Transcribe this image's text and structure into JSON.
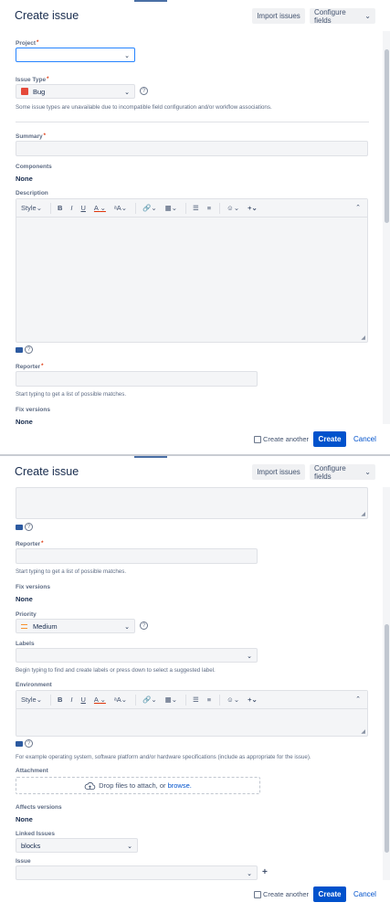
{
  "dialog_title": "Create issue",
  "header": {
    "import_label": "Import issues",
    "configure_label": "Configure fields",
    "configure_caret": "⌄"
  },
  "fields": {
    "project_label": "Project",
    "required_mark": "*",
    "issue_type_label": "Issue Type",
    "issue_type_value": "Bug",
    "issue_type_help": "Some issue types are unavailable due to incompatible field configuration and/or workflow associations.",
    "summary_label": "Summary",
    "components_label": "Components",
    "components_value": "None",
    "description_label": "Description",
    "reporter_label": "Reporter",
    "reporter_help": "Start typing to get a list of possible matches.",
    "fix_versions_label": "Fix versions",
    "fix_versions_value": "None",
    "priority_label": "Priority",
    "priority_value": "Medium",
    "labels_label": "Labels",
    "labels_help": "Begin typing to find and create labels or press down to select a suggested label.",
    "environment_label": "Environment",
    "environment_help": "For example operating system, software platform and/or hardware specifications (include as appropriate for the issue).",
    "attachment_label": "Attachment",
    "attachment_text": "Drop files to attach, or",
    "attachment_link": "browse.",
    "affects_label": "Affects versions",
    "affects_value": "None",
    "linked_label": "Linked Issues",
    "linked_value": "blocks",
    "issue_label": "Issue",
    "add_icon": "+"
  },
  "toolbar": {
    "style": "Style",
    "bold": "B",
    "italic": "I",
    "underline": "U",
    "text_color": "A",
    "more_format": "ᵃA",
    "link": "🔗",
    "table": "▦",
    "bullet": "☰",
    "numbered": "≡",
    "emoji": "☺",
    "insert": "+",
    "dropdown": "⌄",
    "collapse": "⌃"
  },
  "footer": {
    "create_another": "Create another",
    "create": "Create",
    "cancel": "Cancel"
  },
  "colors": {
    "primary": "#0052cc",
    "required": "#de350b",
    "bug": "#e5493a",
    "priority": "#f79232"
  }
}
